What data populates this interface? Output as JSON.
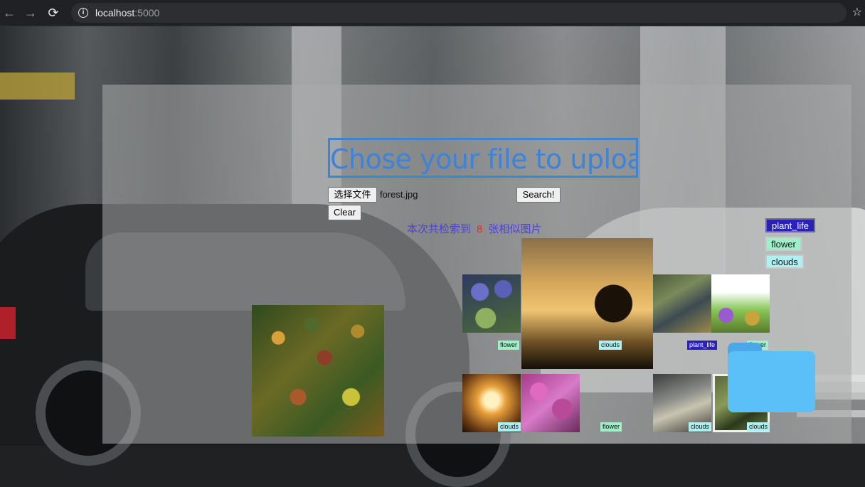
{
  "browser": {
    "url_host": "localhost",
    "url_port": ":5000"
  },
  "page": {
    "title": "Chose your file to upload",
    "choose_file_label": "选择文件",
    "file_name": "forest.jpg",
    "search_label": "Search!",
    "clear_label": "Clear",
    "result_prefix": "本次共检索到",
    "result_count": "8",
    "result_suffix": "张相似图片"
  },
  "tag_buttons": [
    "plant_life",
    "flower",
    "clouds"
  ],
  "images": [
    {
      "label": "flower"
    },
    {
      "label": "clouds"
    },
    {
      "label": "plant_life"
    },
    {
      "label": "flower"
    },
    {
      "label": "clouds"
    },
    {
      "label": "flower"
    },
    {
      "label": "clouds"
    },
    {
      "label": "clouds"
    }
  ],
  "colors": {
    "accent": "#3d83d8",
    "result_text": "#4b3fe0",
    "count": "#e23030",
    "plant_life_tag": "#2a20b8",
    "flower_tag": "#9ff0c8",
    "clouds_tag": "#aff1f3"
  }
}
